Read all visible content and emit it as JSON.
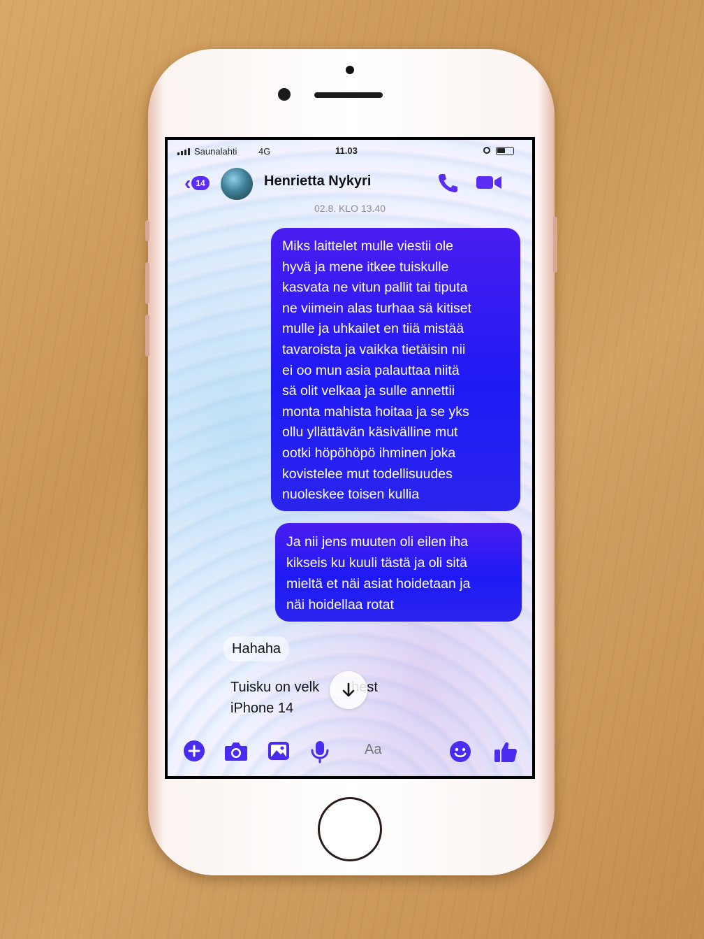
{
  "status_bar": {
    "carrier": "Saunalahti",
    "network": "4G",
    "time": "11.03"
  },
  "header": {
    "back_count": "14",
    "contact_name": "Henrietta Nykyri",
    "call_icon": "phone-icon",
    "video_icon": "video-camera-icon"
  },
  "conversation": {
    "timestamp": "02.8. KLO 13.40",
    "sent_messages": [
      {
        "lines": [
          "Miks laittelet mulle viestii ole",
          "hyvä ja mene itkee tuiskulle",
          "kasvata ne vitun pallit tai tiputa",
          "ne viimein alas turhaa sä kitiset",
          "mulle ja uhkailet en tiiä mistää",
          "tavaroista ja vaikka tietäisin nii",
          "ei oo mun asia palauttaa niitä",
          "sä olit velkaa ja sulle annettii",
          "monta mahista hoitaa ja se yks",
          "ollu yllättävän käsivälline mut",
          "ootki höpöhöpö ihminen joka",
          "kovistelee mut todellisuudes",
          "nuoleskee toisen kullia"
        ]
      },
      {
        "lines": [
          "Ja nii jens muuten oli eilen iha",
          "kikseis ku kuuli tästä ja oli sitä",
          "mieltä et näi asiat hoidetaan ja",
          "näi hoidellaa rotat"
        ]
      }
    ],
    "received_messages": [
      {
        "text": "Hahaha"
      },
      {
        "line1": "Tuisku on velk",
        "line1_end": "hest",
        "line2": "iPhone 14"
      }
    ]
  },
  "composer": {
    "placeholder": "Aa",
    "icons": [
      "plus-icon",
      "camera-icon",
      "gallery-icon",
      "microphone-icon",
      "emoji-icon",
      "thumbs-up-icon"
    ]
  },
  "colors": {
    "accent": "#5b2cf5",
    "bubble": "#2a1ef2"
  }
}
